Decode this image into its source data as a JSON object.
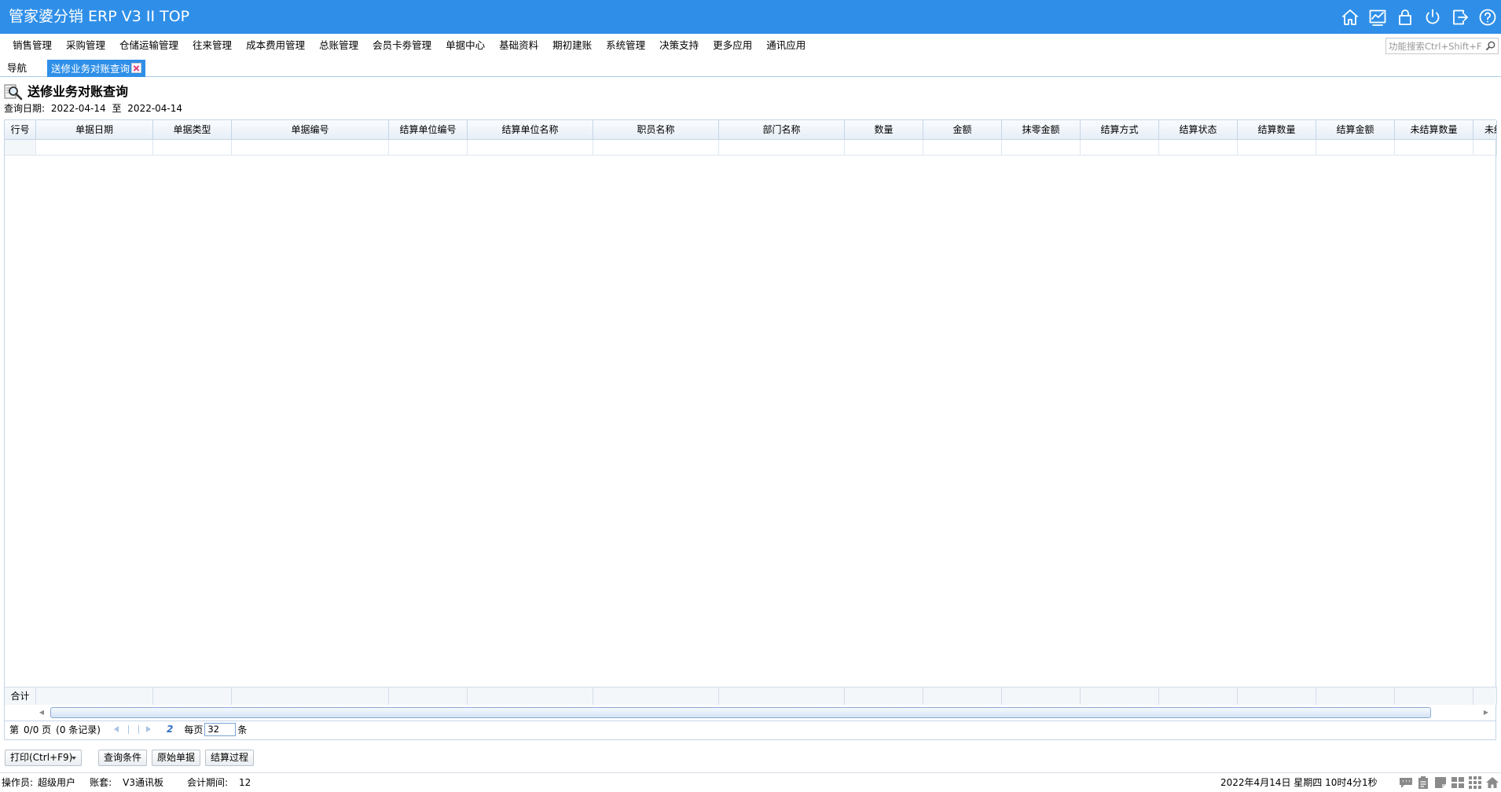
{
  "app": {
    "title": "管家婆分销 ERP V3 II TOP"
  },
  "title_icons": [
    "home-icon",
    "chart-icon",
    "lock-icon",
    "power-icon",
    "logout-icon",
    "help-icon"
  ],
  "menu": {
    "items": [
      "销售管理",
      "采购管理",
      "仓储运输管理",
      "往来管理",
      "成本费用管理",
      "总账管理",
      "会员卡劵管理",
      "单据中心",
      "基础资料",
      "期初建账",
      "系统管理",
      "决策支持",
      "更多应用",
      "通讯应用"
    ],
    "search_placeholder": "功能搜索Ctrl+Shift+F"
  },
  "tabs": {
    "nav_label": "导航",
    "active_label": "送修业务对账查询"
  },
  "report": {
    "title": "送修业务对账查询",
    "date_label": "查询日期:",
    "date_from": "2022-04-14",
    "date_sep": "至",
    "date_to": "2022-04-14"
  },
  "grid": {
    "columns": [
      "行号",
      "单据日期",
      "单据类型",
      "单据编号",
      "结算单位编号",
      "结算单位名称",
      "职员名称",
      "部门名称",
      "数量",
      "金额",
      "抹零金额",
      "结算方式",
      "结算状态",
      "结算数量",
      "结算金额",
      "未结算数量",
      "未结"
    ],
    "total_label": "合计"
  },
  "pager": {
    "page_prefix": "第",
    "page_info": "0/0 页",
    "records": "(0 条记录)",
    "refresh_glyph": "2",
    "per_page_label": "每页",
    "page_size": "32",
    "unit": "条"
  },
  "buttons": {
    "print": "打印(Ctrl+F9)",
    "query": "查询条件",
    "original": "原始单据",
    "settle": "结算过程"
  },
  "status": {
    "operator_label": "操作员:",
    "operator": "超级用户",
    "account_label": "账套:",
    "account": "V3通讯板",
    "period_label": "会计期间:",
    "period": "12",
    "datetime": "2022年4月14日 星期四 10时4分1秒"
  },
  "colors": {
    "accent": "#2f8fe8"
  }
}
